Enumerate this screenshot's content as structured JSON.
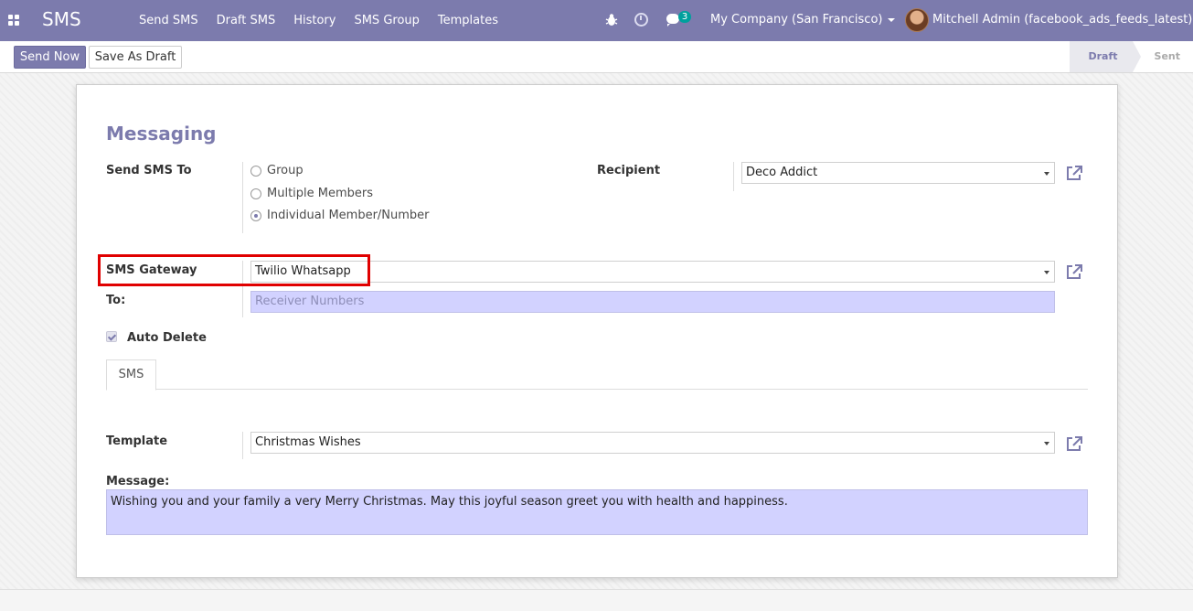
{
  "navbar": {
    "brand": "SMS",
    "menu": [
      "Send SMS",
      "Draft SMS",
      "History",
      "SMS Group",
      "Templates"
    ],
    "chat_count": "3",
    "company": "My Company (San Francisco)",
    "user": "Mitchell Admin (facebook_ads_feeds_latest)"
  },
  "control": {
    "send_now": "Send Now",
    "save_draft": "Save As Draft",
    "stages": [
      "Draft",
      "Sent"
    ]
  },
  "form": {
    "title": "Messaging",
    "send_sms_to_label": "Send SMS To",
    "options": [
      "Group",
      "Multiple Members",
      "Individual Member/Number"
    ],
    "selected_option": "Individual Member/Number",
    "recipient_label": "Recipient",
    "recipient_value": "Deco Addict",
    "gateway_label": "SMS Gateway",
    "gateway_value": "Twilio Whatsapp",
    "to_label": "To:",
    "to_placeholder": "Receiver Numbers",
    "auto_delete_label": "Auto Delete",
    "tab_label": "SMS",
    "template_label": "Template",
    "template_value": "Christmas Wishes",
    "message_label": "Message:",
    "message_value": "Wishing you and your family a very Merry Christmas. May this joyful season greet you with health and happiness."
  },
  "colors": {
    "primary": "#7c7bad",
    "input_highlight": "#d2d2ff",
    "annotation_red": "#e00000",
    "badge": "#00a09d"
  }
}
